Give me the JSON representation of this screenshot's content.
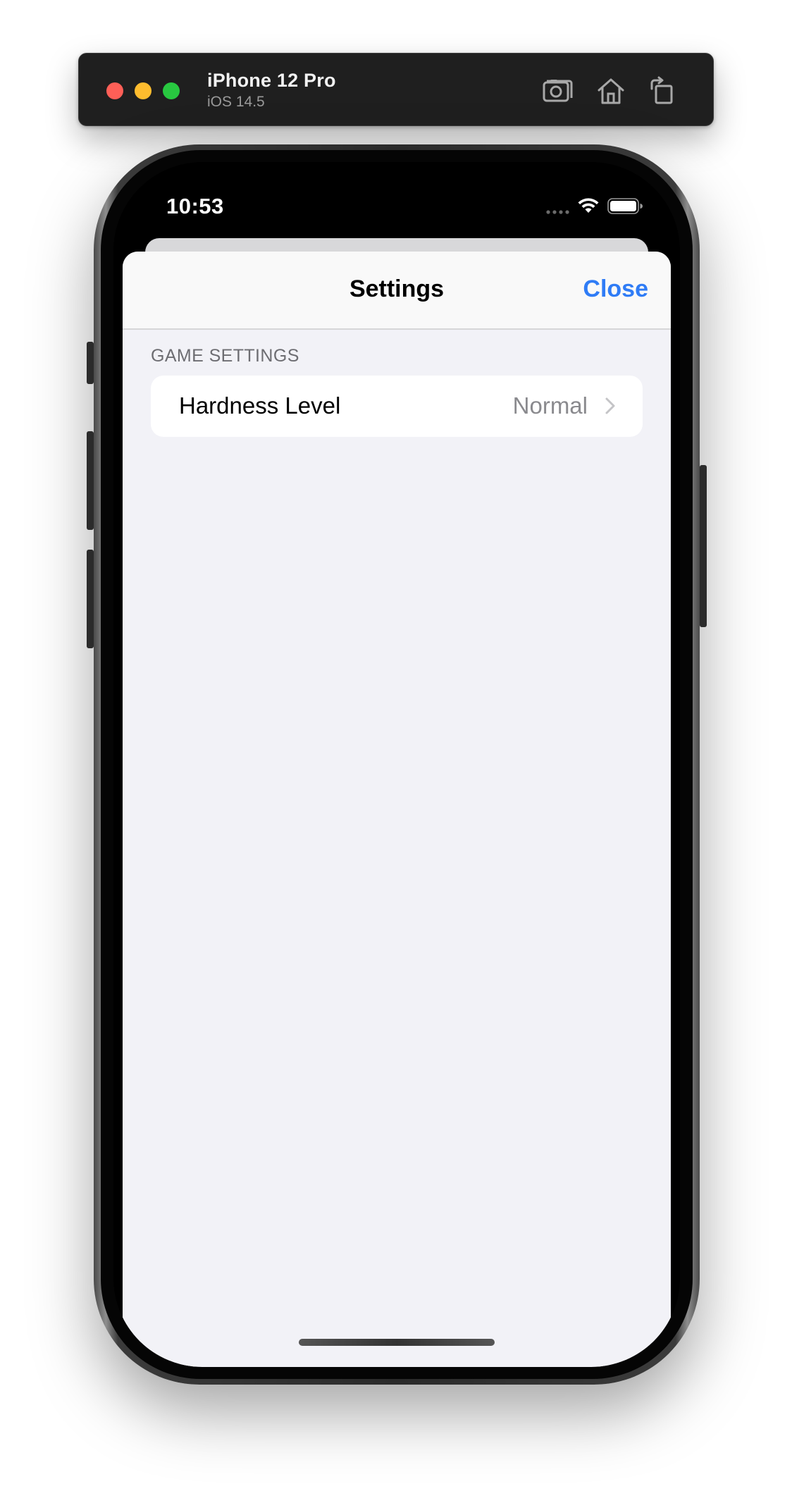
{
  "simulator": {
    "device_name": "iPhone 12 Pro",
    "os_version": "iOS 14.5",
    "toolbar_icons": [
      "screenshot-icon",
      "home-icon",
      "rotate-icon"
    ]
  },
  "status_bar": {
    "time": "10:53",
    "icons": [
      "cellular-dots-icon",
      "wifi-icon",
      "battery-icon"
    ]
  },
  "nav": {
    "title": "Settings",
    "close_label": "Close"
  },
  "sections": [
    {
      "header": "GAME SETTINGS",
      "rows": [
        {
          "label": "Hardness Level",
          "value": "Normal",
          "accessory": "chevron-right-icon"
        }
      ]
    }
  ],
  "colors": {
    "accent": "#2f7cf6",
    "grouped_background": "#f2f2f7",
    "secondary_text": "#8a8a8e",
    "section_header": "#6d6d72"
  }
}
